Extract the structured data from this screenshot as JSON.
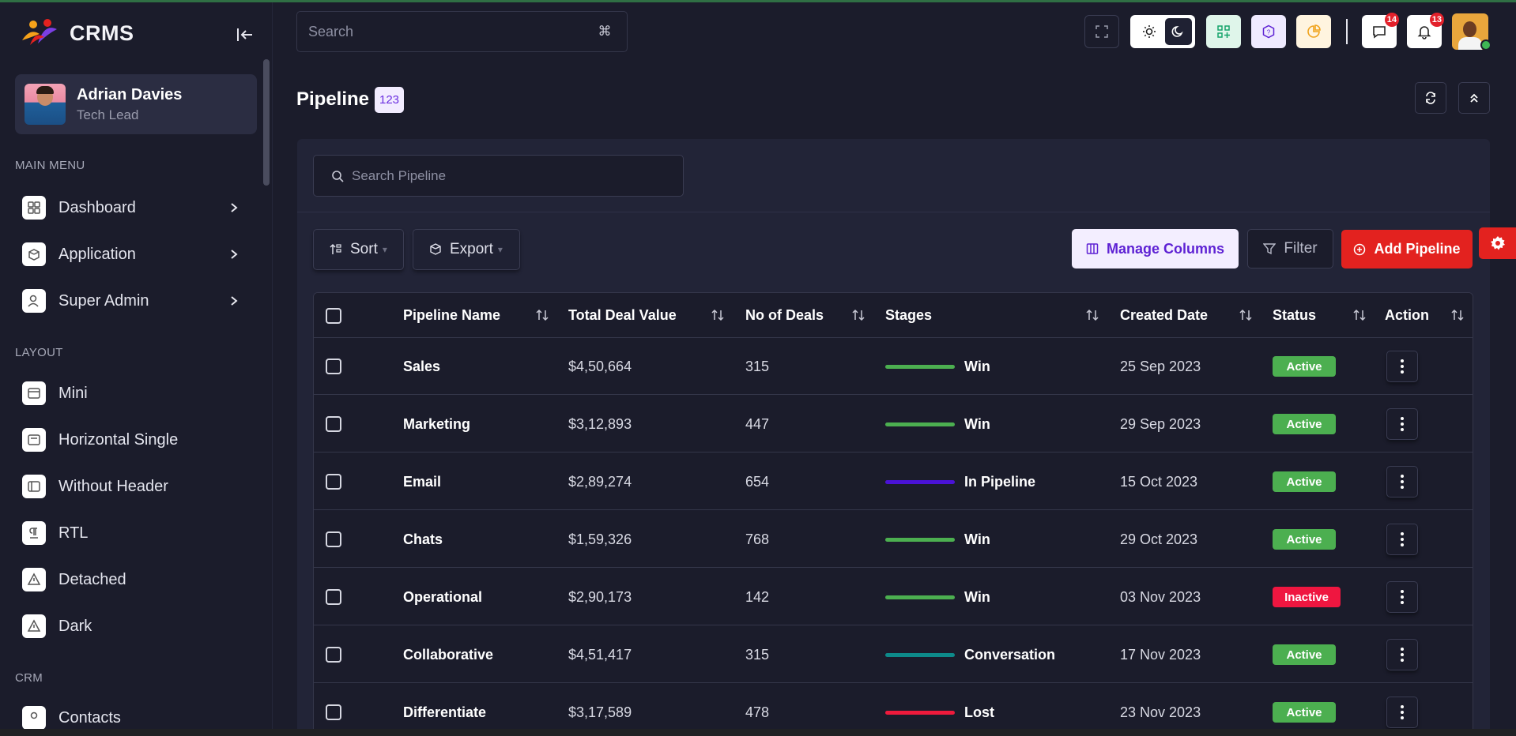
{
  "app": {
    "name": "CRMS"
  },
  "user": {
    "name": "Adrian Davies",
    "role": "Tech Lead"
  },
  "sidebar": {
    "sections": [
      {
        "label": "MAIN MENU"
      },
      {
        "label": "LAYOUT"
      },
      {
        "label": "CRM"
      }
    ],
    "main_menu": [
      {
        "label": "Dashboard",
        "icon": "dashboard-icon"
      },
      {
        "label": "Application",
        "icon": "application-icon"
      },
      {
        "label": "Super Admin",
        "icon": "super-admin-icon"
      }
    ],
    "layout": [
      {
        "label": "Mini",
        "icon": "mini-layout-icon"
      },
      {
        "label": "Horizontal Single",
        "icon": "horizontal-layout-icon"
      },
      {
        "label": "Without Header",
        "icon": "without-header-icon"
      },
      {
        "label": "RTL",
        "icon": "rtl-icon"
      },
      {
        "label": "Detached",
        "icon": "detached-icon"
      },
      {
        "label": "Dark",
        "icon": "dark-icon"
      }
    ],
    "crm": [
      {
        "label": "Contacts",
        "icon": "contacts-icon"
      }
    ]
  },
  "header": {
    "search_placeholder": "Search",
    "search_shortcut": "⌘",
    "notifications": {
      "messages_count": "14",
      "alerts_count": "13"
    }
  },
  "page": {
    "title": "Pipeline",
    "count": "123",
    "search_placeholder": "Search Pipeline"
  },
  "toolbar": {
    "sort_label": "Sort",
    "export_label": "Export",
    "manage_columns_label": "Manage Columns",
    "filter_label": "Filter",
    "add_label": "Add Pipeline"
  },
  "table": {
    "columns": [
      "Pipeline Name",
      "Total Deal Value",
      "No of Deals",
      "Stages",
      "Created Date",
      "Status",
      "Action"
    ],
    "rows": [
      {
        "name": "Sales",
        "value": "$4,50,664",
        "deals": "315",
        "stage": "Win",
        "stage_color": "#4caf50",
        "date": "25 Sep 2023",
        "status": "Active"
      },
      {
        "name": "Marketing",
        "value": "$3,12,893",
        "deals": "447",
        "stage": "Win",
        "stage_color": "#4caf50",
        "date": "29 Sep 2023",
        "status": "Active"
      },
      {
        "name": "Email",
        "value": "$2,89,274",
        "deals": "654",
        "stage": "In Pipeline",
        "stage_color": "#4a12d6",
        "date": "15 Oct 2023",
        "status": "Active"
      },
      {
        "name": "Chats",
        "value": "$1,59,326",
        "deals": "768",
        "stage": "Win",
        "stage_color": "#4caf50",
        "date": "29 Oct 2023",
        "status": "Active"
      },
      {
        "name": "Operational",
        "value": "$2,90,173",
        "deals": "142",
        "stage": "Win",
        "stage_color": "#4caf50",
        "date": "03 Nov 2023",
        "status": "Inactive"
      },
      {
        "name": "Collaborative",
        "value": "$4,51,417",
        "deals": "315",
        "stage": "Conversation",
        "stage_color": "#0d8a8a",
        "date": "17 Nov 2023",
        "status": "Active"
      },
      {
        "name": "Differentiate",
        "value": "$3,17,589",
        "deals": "478",
        "stage": "Lost",
        "stage_color": "#ef1a3c",
        "date": "23 Nov 2023",
        "status": "Active"
      }
    ]
  },
  "colors": {
    "status_active": "#4caf50",
    "status_inactive": "#ef1640",
    "accent_red": "#e3221f",
    "accent_purple": "#5e22d4"
  }
}
